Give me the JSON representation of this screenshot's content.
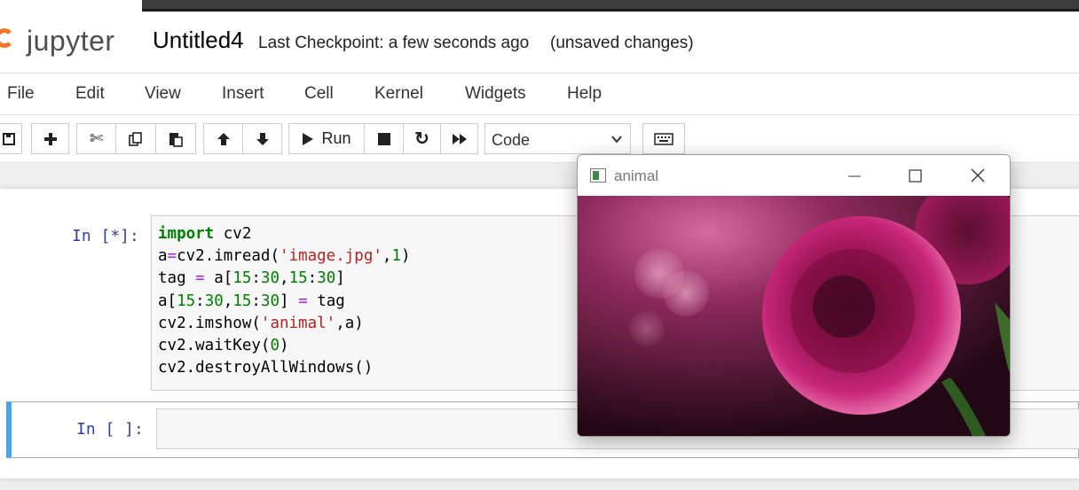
{
  "header": {
    "logo_text": "jupyter",
    "notebook_name": "Untitled4",
    "checkpoint": "Last Checkpoint: a few seconds ago",
    "status": "(unsaved changes)"
  },
  "menu": [
    "File",
    "Edit",
    "View",
    "Insert",
    "Cell",
    "Kernel",
    "Widgets",
    "Help"
  ],
  "toolbar": {
    "run_label": "Run",
    "cell_type": "Code",
    "icons": [
      "save-icon",
      "plus-icon",
      "scissors-icon",
      "copy-icon",
      "paste-icon",
      "arrow-up-icon",
      "arrow-down-icon",
      "run-icon",
      "stop-icon",
      "restart-icon",
      "fast-forward-icon",
      "keyboard-icon"
    ]
  },
  "cells": [
    {
      "prompt": "In [*]:",
      "code": [
        [
          {
            "t": "import",
            "c": "kw"
          },
          {
            "t": " cv2",
            "c": ""
          }
        ],
        [
          {
            "t": "a",
            "c": ""
          },
          {
            "t": "=",
            "c": "op"
          },
          {
            "t": "cv2.imread(",
            "c": ""
          },
          {
            "t": "'image.jpg'",
            "c": "st"
          },
          {
            "t": ",",
            "c": ""
          },
          {
            "t": "1",
            "c": "nm"
          },
          {
            "t": ")",
            "c": ""
          }
        ],
        [
          {
            "t": "tag ",
            "c": ""
          },
          {
            "t": "=",
            "c": "op"
          },
          {
            "t": " a[",
            "c": ""
          },
          {
            "t": "15",
            "c": "nm"
          },
          {
            "t": ":",
            "c": ""
          },
          {
            "t": "30",
            "c": "nm"
          },
          {
            "t": ",",
            "c": ""
          },
          {
            "t": "15",
            "c": "nm"
          },
          {
            "t": ":",
            "c": ""
          },
          {
            "t": "30",
            "c": "nm"
          },
          {
            "t": "]",
            "c": ""
          }
        ],
        [
          {
            "t": "a[",
            "c": ""
          },
          {
            "t": "15",
            "c": "nm"
          },
          {
            "t": ":",
            "c": ""
          },
          {
            "t": "30",
            "c": "nm"
          },
          {
            "t": ",",
            "c": ""
          },
          {
            "t": "15",
            "c": "nm"
          },
          {
            "t": ":",
            "c": ""
          },
          {
            "t": "30",
            "c": "nm"
          },
          {
            "t": "] ",
            "c": ""
          },
          {
            "t": "=",
            "c": "op"
          },
          {
            "t": " tag",
            "c": ""
          }
        ],
        [
          {
            "t": "cv2.imshow(",
            "c": ""
          },
          {
            "t": "'animal'",
            "c": "st"
          },
          {
            "t": ",a)",
            "c": ""
          }
        ],
        [
          {
            "t": "cv2.waitKey(",
            "c": ""
          },
          {
            "t": "0",
            "c": "nm"
          },
          {
            "t": ")",
            "c": ""
          }
        ],
        [
          {
            "t": "cv2.destroyAllWindows()",
            "c": ""
          }
        ]
      ]
    },
    {
      "prompt": "In [ ]:"
    }
  ],
  "popup": {
    "title": "animal",
    "image_description_icon": "flower-photo"
  },
  "colors": {
    "accent": "#42a5f5",
    "prompt": "#303f9f",
    "logo_orange": "#f37626"
  }
}
